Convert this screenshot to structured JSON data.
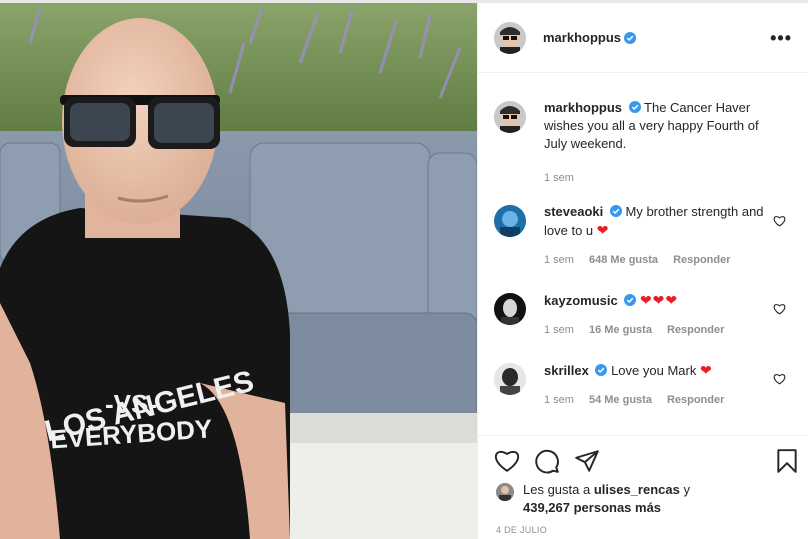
{
  "post": {
    "username": "markhoppus",
    "more_icon": "ellipsis-icon",
    "caption": {
      "username": "markhoppus",
      "text": "The Cancer Haver wishes you all a very happy Fourth of July weekend.",
      "time": "1 sem"
    },
    "shirt_text": [
      "LOS ANGELES",
      "-VS-",
      "EVERYBODY"
    ],
    "comments": [
      {
        "username": "steveaoki",
        "text": "My brother strength and love to u",
        "hearts": "❤",
        "time": "1 sem",
        "likes": "648 Me gusta",
        "reply": "Responder"
      },
      {
        "username": "kayzomusic",
        "text": "",
        "hearts": "❤❤❤",
        "time": "1 sem",
        "likes": "16 Me gusta",
        "reply": "Responder"
      },
      {
        "username": "skrillex",
        "text": "Love you Mark",
        "hearts": "❤",
        "time": "1 sem",
        "likes": "54 Me gusta",
        "reply": "Responder"
      }
    ],
    "likes": {
      "prefix": "Les gusta a",
      "user": "ulises_rencas",
      "conj": "y",
      "count": "439,267 personas más"
    },
    "date": "4 DE JULIO"
  },
  "colors": {
    "verified": "#3897f0",
    "heart": "#ed1c24",
    "muted": "#8e8e8e"
  }
}
